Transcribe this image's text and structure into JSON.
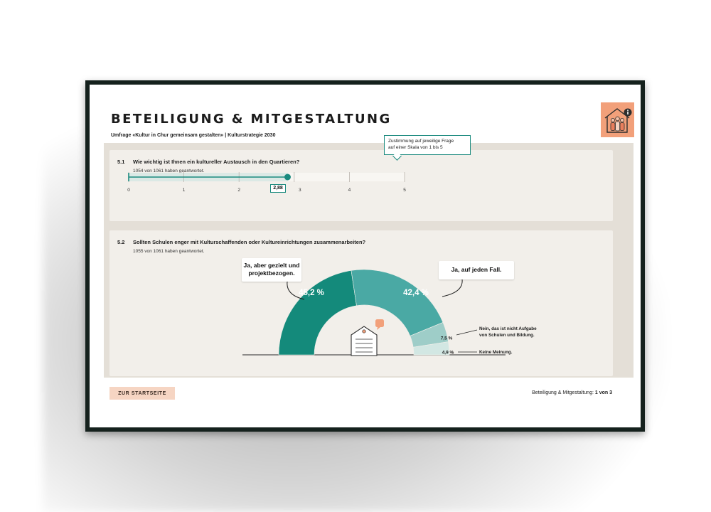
{
  "page": {
    "title": "BETEILIGUNG & MITGESTALTUNG",
    "subtitle": "Umfrage «Kultur in Chur gemeinsam gestalten» | Kulturstrategie 2030"
  },
  "tooltip": {
    "line1": "Zustimmung auf jeweilige Frage",
    "line2": "auf einer Skala von 1 bis 5"
  },
  "question1": {
    "number": "5.1",
    "text": "Wie wichtig ist Ihnen ein kultureller Austausch in den Quartieren?",
    "responses": "1054 von 1061 haben geantwortet.",
    "value_label": "2,88"
  },
  "question2": {
    "number": "5.2",
    "text": "Sollten Schulen enger mit Kulturschaffenden oder Kultureinrichtungen zusammenarbeiten?",
    "responses": "1055 von 1061 haben geantwortet."
  },
  "chart_data": [
    {
      "type": "bar",
      "categories": [
        "Wie wichtig ist Ihnen ein kultureller Austausch in den Quartieren?"
      ],
      "values": [
        2.88
      ],
      "value_label": "2,88",
      "xlim": [
        0,
        5
      ],
      "ticks": [
        "0",
        "1",
        "2",
        "3",
        "4",
        "5"
      ],
      "grid": true
    },
    {
      "type": "pie",
      "categories": [
        "Ja, aber gezielt und projektbezogen.",
        "Ja, auf jeden Fall.",
        "Nein, das ist nicht Aufgabe von Schulen und Bildung.",
        "Keine Meinung."
      ],
      "values": [
        45.2,
        42.4,
        7.5,
        4.9
      ],
      "labels": [
        "45,2 %",
        "42,4 %",
        "7,5 %",
        "4,9 %"
      ],
      "colors": [
        "#148a7b",
        "#4aa9a4",
        "#9ecdc8",
        "#d2e7e3"
      ]
    }
  ],
  "donut_labels": {
    "left_callout_line1": "Ja, aber gezielt und",
    "left_callout_line2": "projektbezogen.",
    "right_callout": "Ja, auf jeden Fall.",
    "side1_line1": "Nein, das ist nicht Aufgabe",
    "side1_line2": "von Schulen und Bildung.",
    "side2": "Keine Meinung."
  },
  "footer": {
    "button_label": "ZUR STARTSEITE",
    "page_text": "Beteiligung & Mitgestaltung: ",
    "page_number": "1 von 3"
  },
  "colors": {
    "accent_teal": "#1a8a7e",
    "logo_orange": "#f2a07a",
    "button_peach": "#f6d5c3"
  },
  "icons": [
    "house-people-info-icon",
    "clipboard-icon",
    "speech-bubble-icon"
  ]
}
